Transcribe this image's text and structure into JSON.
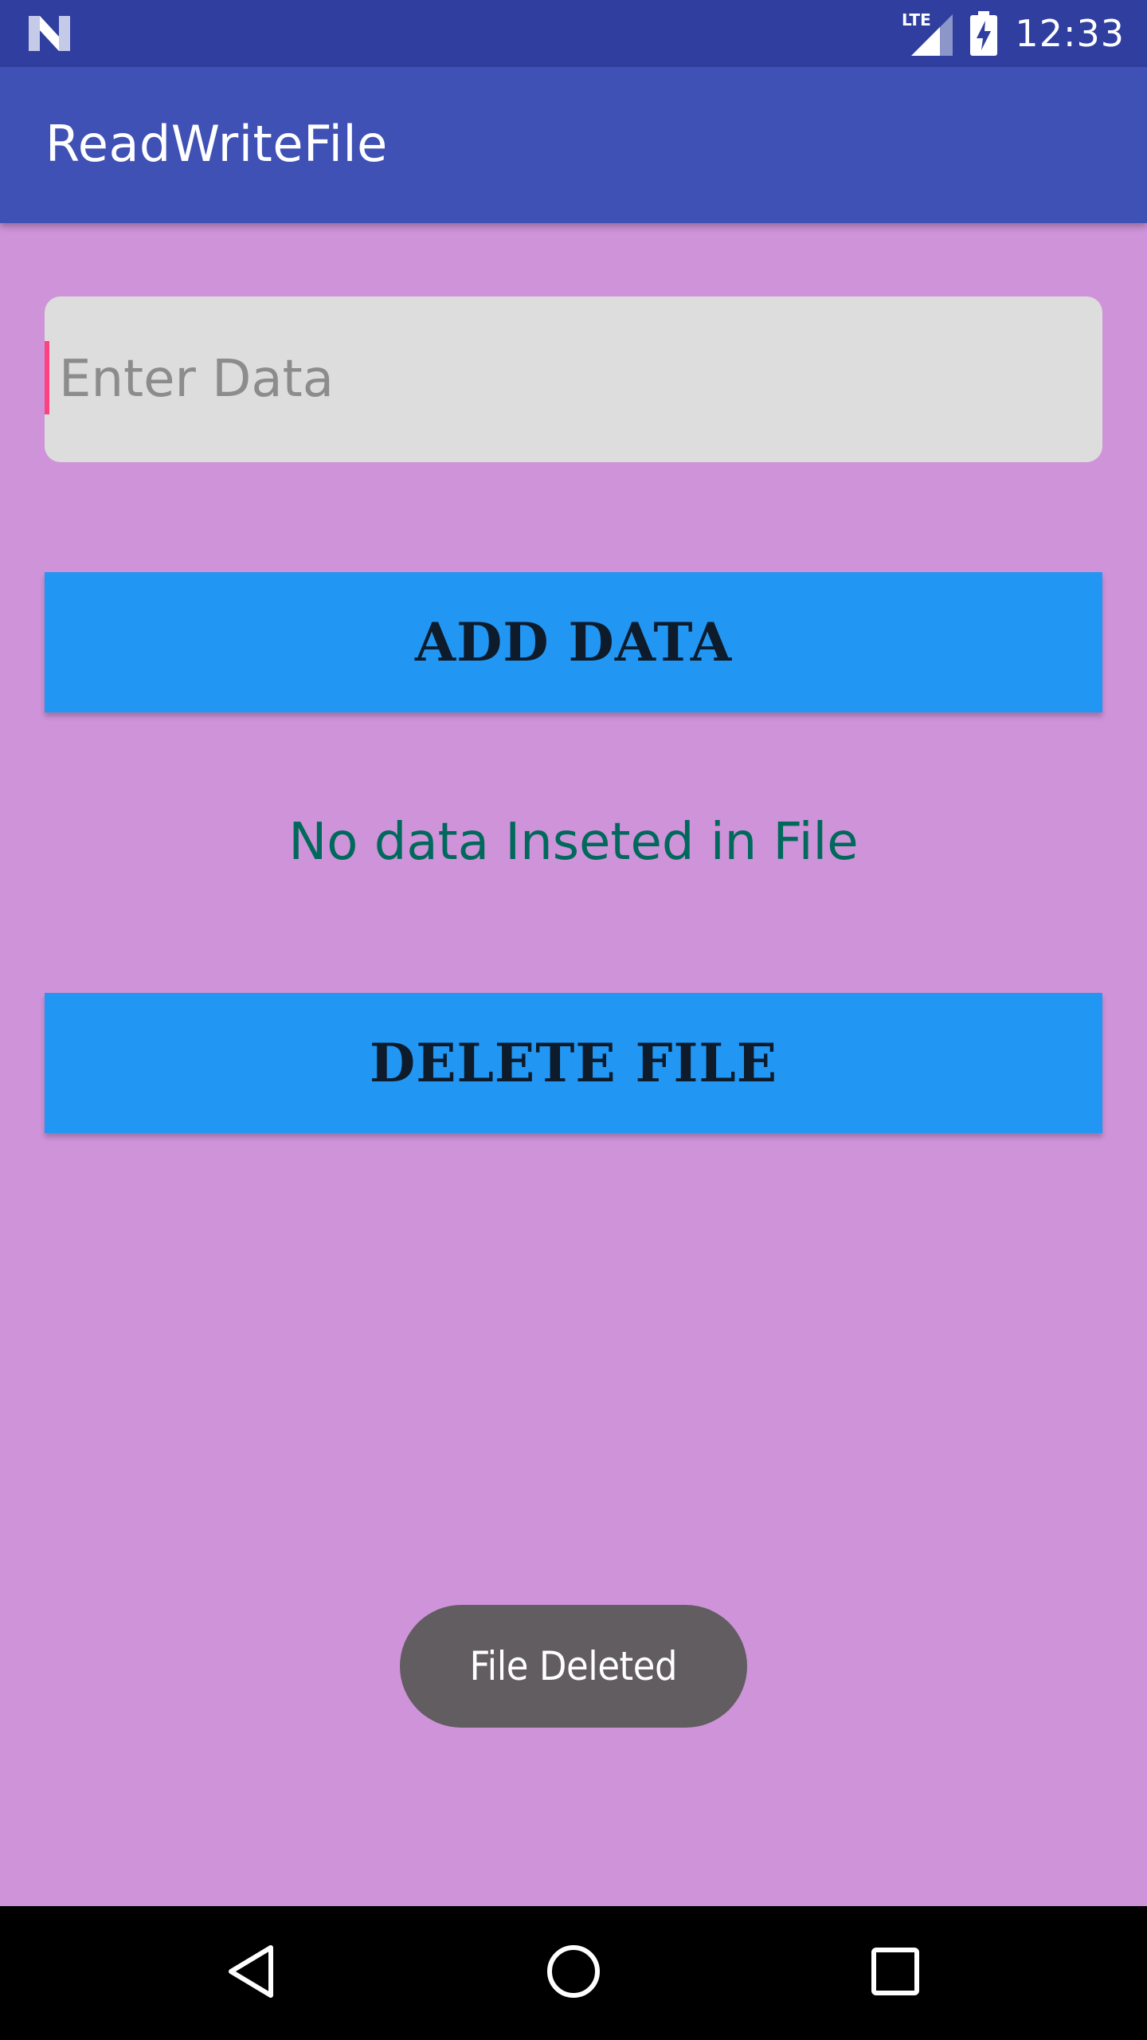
{
  "status_bar": {
    "network_label": "LTE",
    "time": "12:33"
  },
  "app_bar": {
    "title": "ReadWriteFile"
  },
  "input": {
    "value": "",
    "placeholder": "Enter Data"
  },
  "buttons": {
    "add_label": "ADD DATA",
    "delete_label": "DELETE FILE"
  },
  "status_message": "No data Inseted in File",
  "toast": {
    "message": "File Deleted"
  },
  "colors": {
    "status_bar": "#303f9f",
    "app_bar": "#3f51b5",
    "background": "#ce93d8",
    "button": "#2196f3",
    "status_text": "#00695c",
    "cursor_accent": "#ff4081",
    "toast": "#625d61"
  },
  "icons": {
    "status_logo": "android-n-icon",
    "signal": "lte-signal-icon",
    "battery": "battery-charging-icon",
    "nav_back": "back-triangle-icon",
    "nav_home": "home-circle-icon",
    "nav_recent": "recent-square-icon"
  }
}
